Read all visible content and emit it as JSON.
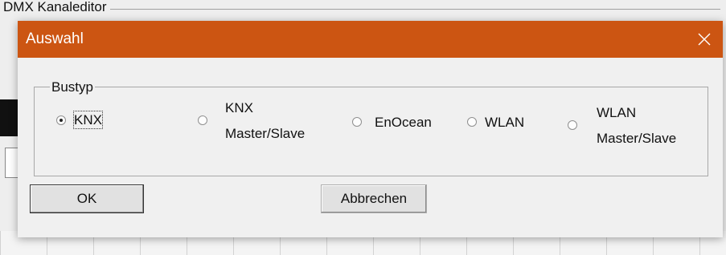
{
  "background_window": {
    "title_fragment": "DMX Kanaleditor"
  },
  "dialog": {
    "title": "Auswahl",
    "titlebar_color": "#cc5512",
    "close_icon": "close-icon",
    "group": {
      "label": "Bustyp",
      "options": [
        {
          "label_lines": [
            "KNX"
          ],
          "selected": true,
          "focused": true
        },
        {
          "label_lines": [
            "KNX",
            "Master/Slave"
          ],
          "selected": false
        },
        {
          "label_lines": [
            "EnOcean"
          ],
          "selected": false
        },
        {
          "label_lines": [
            "WLAN"
          ],
          "selected": false
        },
        {
          "label_lines": [
            "WLAN",
            "Master/Slave"
          ],
          "selected": false
        }
      ]
    },
    "buttons": {
      "ok_label": "OK",
      "cancel_label": "Abbrechen"
    }
  }
}
